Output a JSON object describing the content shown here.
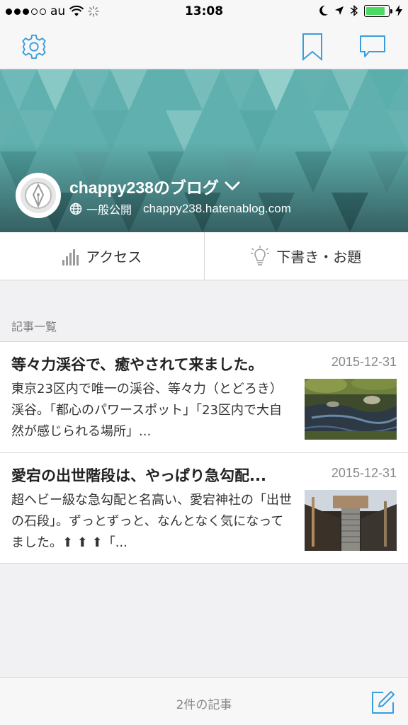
{
  "status_bar": {
    "carrier": "au",
    "time": "13:08",
    "battery_level": 0.85
  },
  "nav": {
    "settings_icon": "gear-icon",
    "bookmark_icon": "bookmark-icon",
    "comment_icon": "speech-bubble-icon",
    "accent_color": "#3a9ddb"
  },
  "blog": {
    "title": "chappy238のブログ",
    "visibility": "一般公開",
    "url": "chappy238.hatenablog.com",
    "header_color": "#5fb0ae"
  },
  "actions": {
    "access_label": "アクセス",
    "drafts_label": "下書き・お題"
  },
  "section": {
    "label": "記事一覧"
  },
  "entries": [
    {
      "title": "等々力渓谷で、癒やされて来ました。",
      "date": "2015-12-31",
      "summary": "東京23区内で唯一の渓谷、等々力（とどろき）渓谷。「都心のパワースポット」「23区内で大自然が感じられる場所」..."
    },
    {
      "title": "愛宕の出世階段は、やっぱり急勾配...",
      "date": "2015-12-31",
      "summary": "超ヘビー級な急勾配と名高い、愛宕神社の「出世の石段」。ずっとずっと、なんとなく気になってました。⬆ ⬆ ⬆「..."
    }
  ],
  "footer": {
    "count_label": "2件の記事",
    "compose_icon": "compose-icon"
  }
}
